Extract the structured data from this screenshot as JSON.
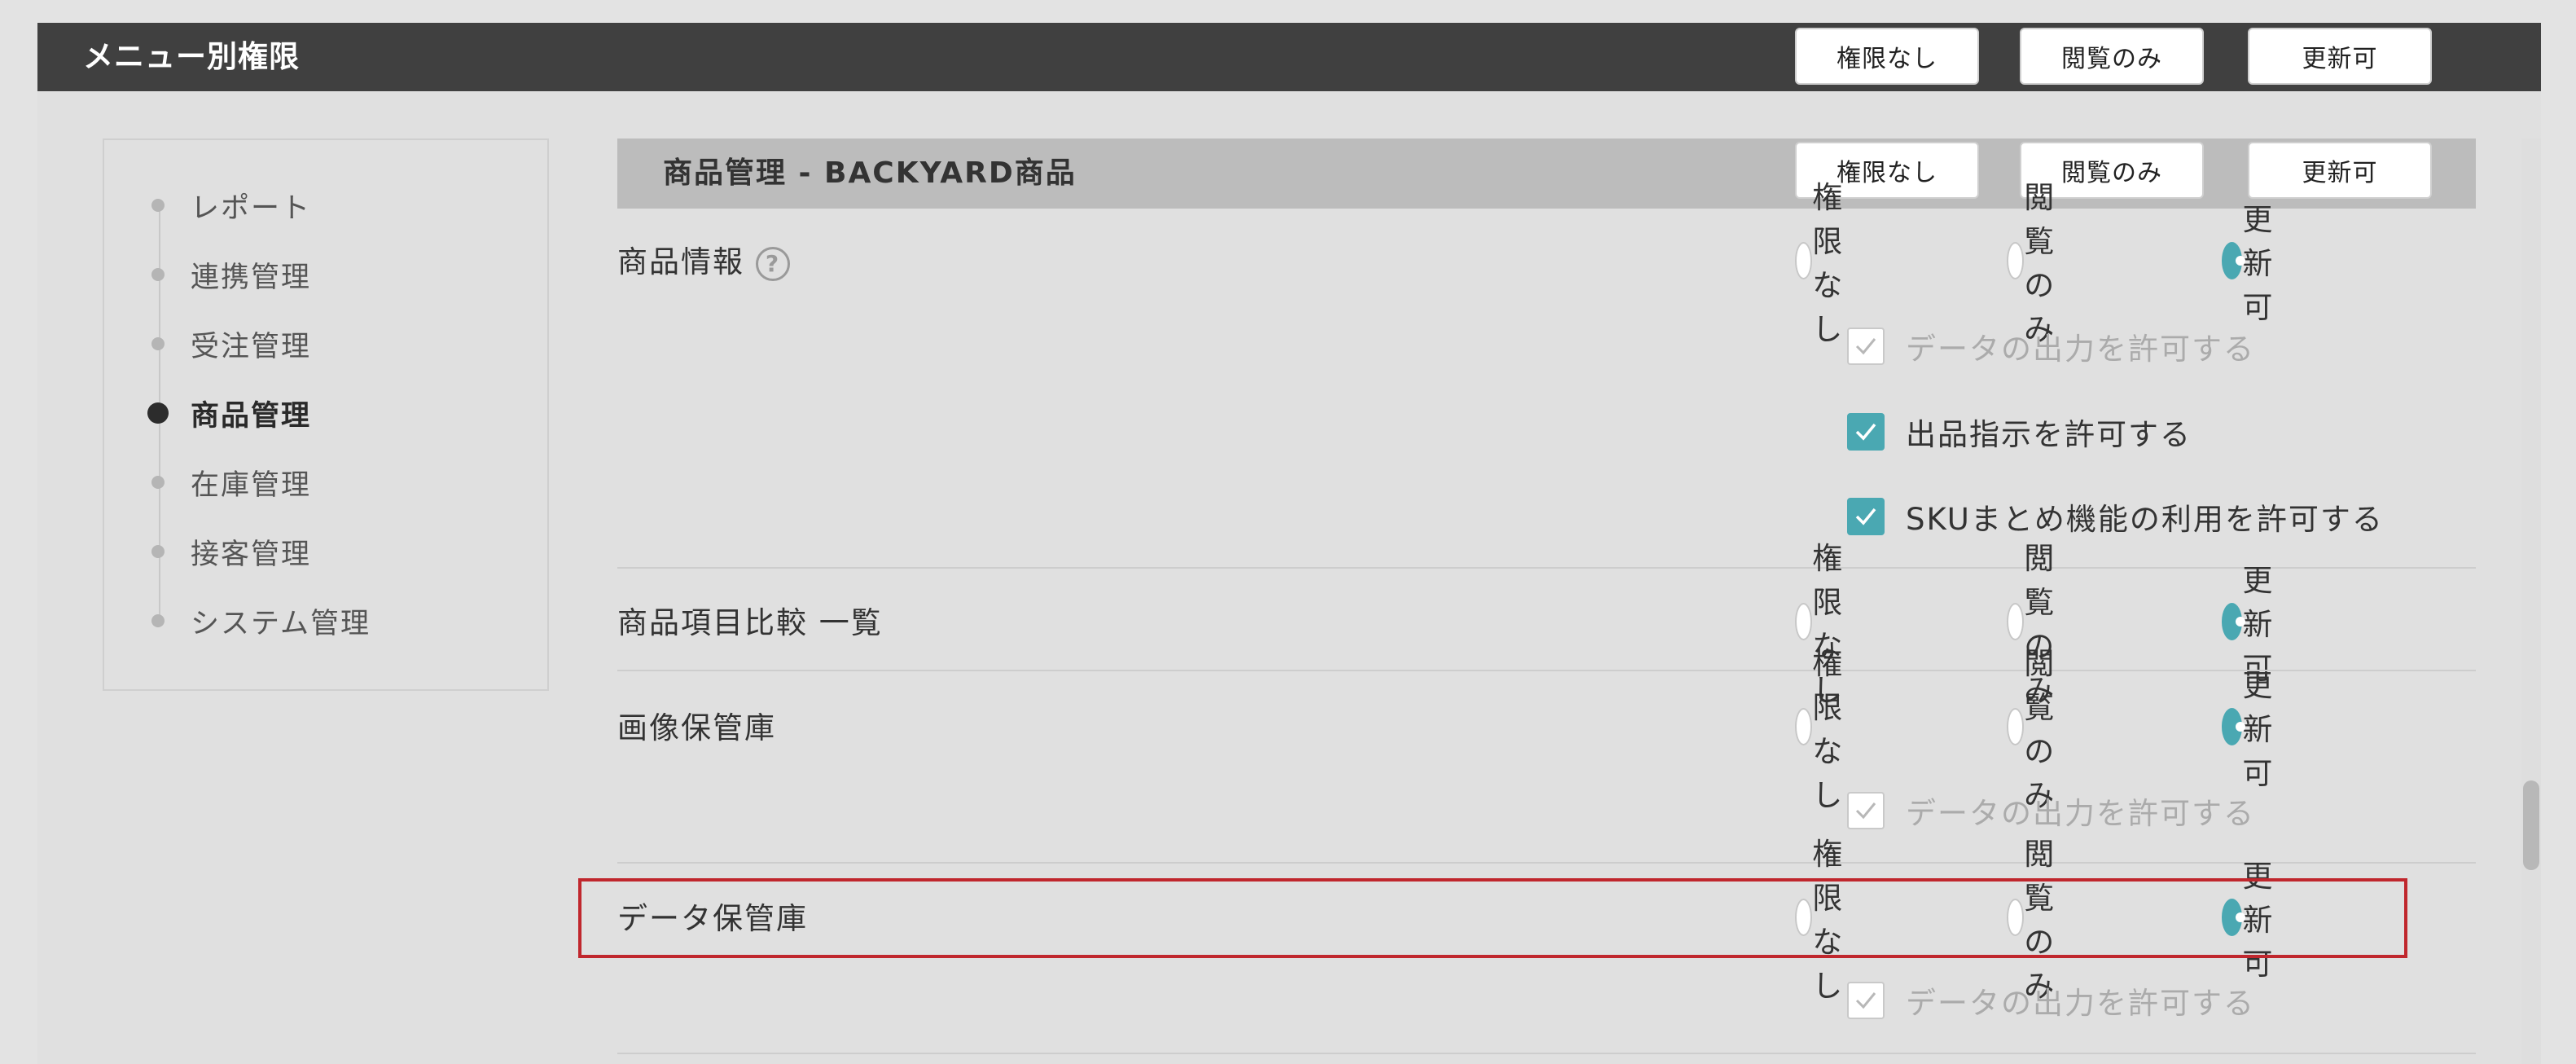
{
  "header": {
    "title": "メニュー別権限",
    "buttons": [
      "権限なし",
      "閲覧のみ",
      "更新可"
    ]
  },
  "sidebar": {
    "items": [
      {
        "label": "レポート",
        "active": false
      },
      {
        "label": "連携管理",
        "active": false
      },
      {
        "label": "受注管理",
        "active": false
      },
      {
        "label": "商品管理",
        "active": true
      },
      {
        "label": "在庫管理",
        "active": false
      },
      {
        "label": "接客管理",
        "active": false
      },
      {
        "label": "システム管理",
        "active": false
      }
    ]
  },
  "section": {
    "title": "商品管理 - BACKYARD商品",
    "buttons": [
      "権限なし",
      "閲覧のみ",
      "更新可"
    ]
  },
  "radio_options": [
    "権限なし",
    "閲覧のみ",
    "更新可"
  ],
  "rows": [
    {
      "label": "商品情報",
      "help_icon": "?",
      "selected": "更新可",
      "checks": [
        {
          "label": "データの出力を許可する",
          "checked": true,
          "disabled": true
        },
        {
          "label": "出品指示を許可する",
          "checked": true,
          "disabled": false
        },
        {
          "label": "SKUまとめ機能の利用を許可する",
          "checked": true,
          "disabled": false
        }
      ]
    },
    {
      "label": "商品項目比較 一覧",
      "selected": "更新可",
      "checks": []
    },
    {
      "label": "画像保管庫",
      "selected": "更新可",
      "checks": [
        {
          "label": "データの出力を許可する",
          "checked": true,
          "disabled": true
        }
      ]
    },
    {
      "label": "データ保管庫",
      "selected": "更新可",
      "highlighted": true,
      "checks": [
        {
          "label": "データの出力を許可する",
          "checked": true,
          "disabled": true
        }
      ]
    }
  ],
  "colors": {
    "accent": "#4aa8b2",
    "highlight_border": "#c0272d",
    "topbar": "#404040"
  }
}
